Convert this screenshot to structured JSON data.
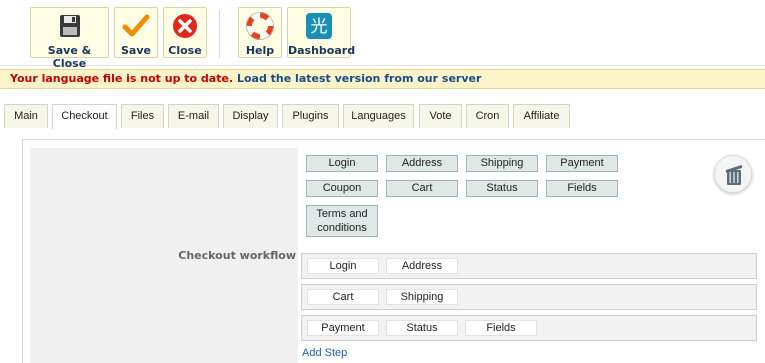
{
  "toolbar": {
    "save_close": "Save & Close",
    "save": "Save",
    "close": "Close",
    "help": "Help",
    "dashboard": "Dashboard",
    "dashboard_glyph": "光"
  },
  "message": {
    "warning": "Your language file is not up to date.",
    "link": "Load the latest version from our server"
  },
  "tabs": [
    "Main",
    "Checkout",
    "Files",
    "E-mail",
    "Display",
    "Plugins",
    "Languages",
    "Vote",
    "Cron",
    "Affiliate"
  ],
  "active_tab": "Checkout",
  "workflow": {
    "label": "Checkout workflow",
    "available": [
      "Login",
      "Address",
      "Shipping",
      "Payment",
      "Coupon",
      "Cart",
      "Status",
      "Fields",
      "Terms and conditions"
    ],
    "steps": [
      [
        "Login",
        "Address"
      ],
      [
        "Cart",
        "Shipping"
      ],
      [
        "Payment",
        "Status",
        "Fields"
      ]
    ],
    "add_step": "Add Step"
  },
  "icons": {
    "save_close": "floppy-disk-icon",
    "save": "checkmark-icon",
    "close": "close-circle-icon",
    "help": "lifebuoy-icon",
    "dashboard": "dashboard-logo-icon",
    "trash": "trash-icon"
  },
  "colors": {
    "warning_text": "#c00000",
    "link_text": "#1a4b8a",
    "message_bg": "#fcf3c8",
    "toolbar_button_bg": "#fffde3",
    "step_bg": "#dfe8e6",
    "add_step_link": "#1a5fa8"
  }
}
